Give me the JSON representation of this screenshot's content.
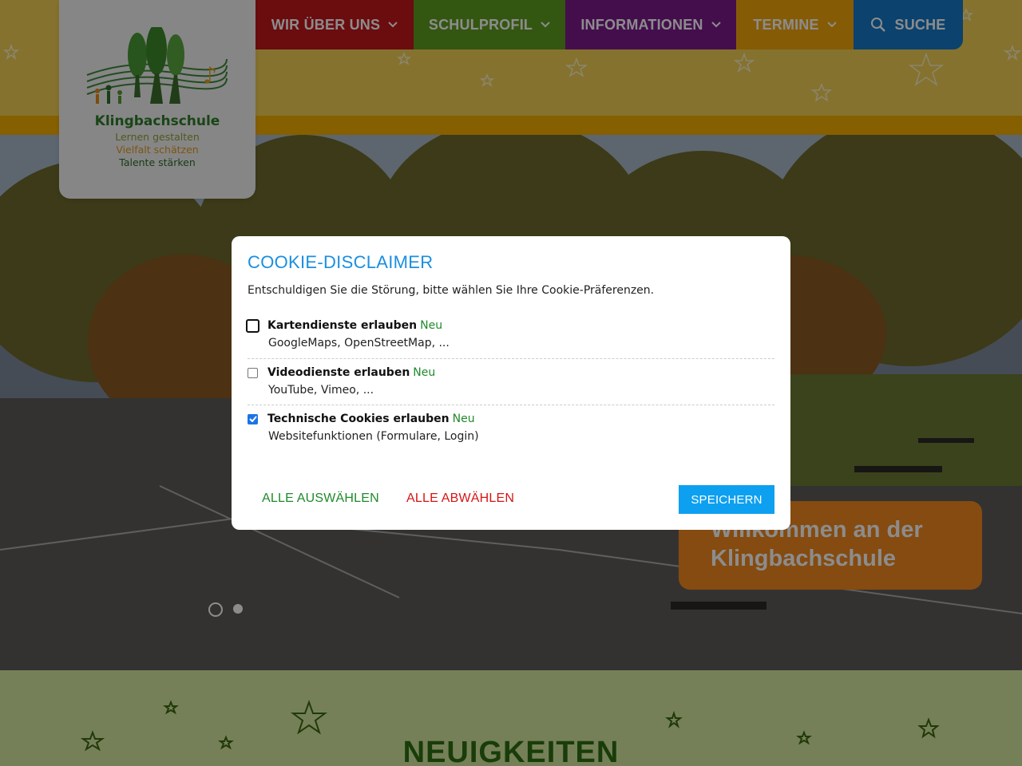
{
  "logo": {
    "name": "Klingbachschule",
    "tagline1": "Lernen gestalten",
    "tagline2": "Vielfalt schätzen",
    "tagline3": "Talente stärken"
  },
  "nav": {
    "items": [
      {
        "label": "WIR ÜBER UNS"
      },
      {
        "label": "SCHULPROFIL"
      },
      {
        "label": "INFORMATIONEN"
      },
      {
        "label": "TERMINE"
      }
    ],
    "search_label": "SUCHE"
  },
  "colors": {
    "header_yellow": "#f3cf55",
    "nav_red": "#c4161c",
    "nav_green": "#5e9d1f",
    "nav_purple": "#7d1a8c",
    "nav_orange": "#f2a60a",
    "nav_blue": "#1478c8",
    "accent_blue": "#0ea0f0"
  },
  "hero": {
    "welcome_line1": "Willkommen an der",
    "welcome_line2": "Klingbachschule",
    "slides_count": 2,
    "active_slide": 1
  },
  "news": {
    "title": "NEUIGKEITEN"
  },
  "cookie_modal": {
    "title": "COOKIE-DISCLAIMER",
    "subtitle": "Entschuldigen Sie die Störung, bitte wählen Sie Ihre Cookie-Präferenzen.",
    "options": [
      {
        "label": "Kartendienste erlauben",
        "badge": "Neu",
        "description": "GoogleMaps, OpenStreetMap, ...",
        "checked": false
      },
      {
        "label": "Videodienste erlauben",
        "badge": "Neu",
        "description": "YouTube, Vimeo, ...",
        "checked": false
      },
      {
        "label": "Technische Cookies erlauben",
        "badge": "Neu",
        "description": "Websitefunktionen (Formulare, Login)",
        "checked": true
      }
    ],
    "select_all_label": "ALLE AUSWÄHLEN",
    "deselect_all_label": "ALLE ABWÄHLEN",
    "save_label": "SPEICHERN"
  },
  "icons": {
    "search": "search-icon",
    "chevron": "chevron-down-icon",
    "check": "check-icon"
  }
}
